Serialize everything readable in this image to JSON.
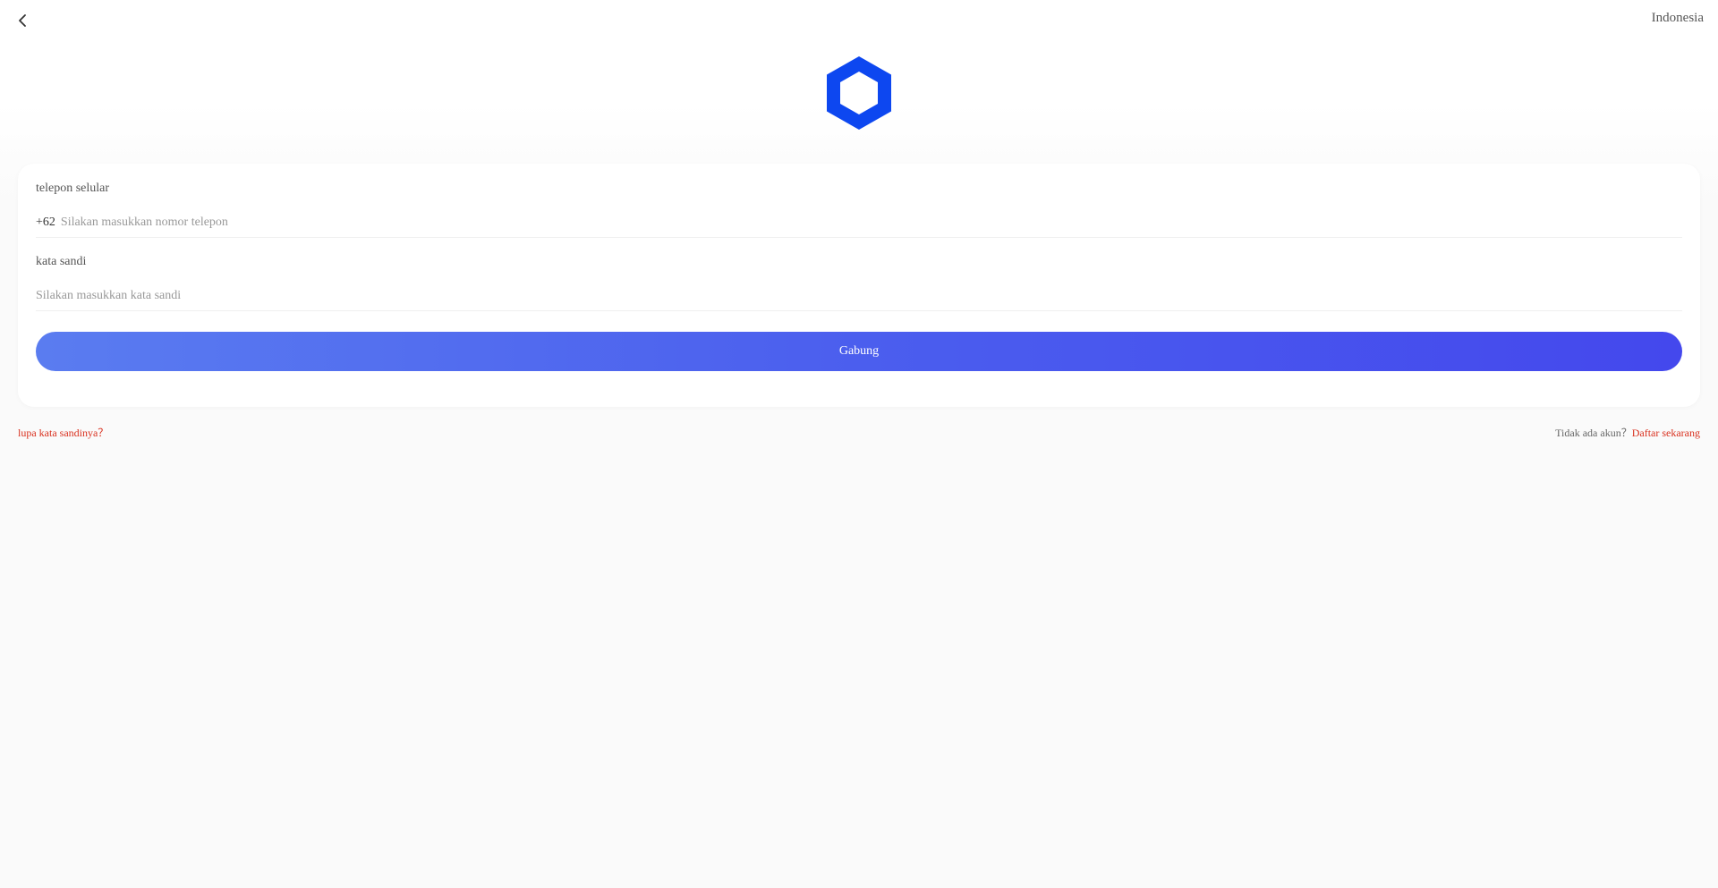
{
  "header": {
    "back_icon": "chevron-left-icon",
    "language": "Indonesia"
  },
  "logo": {
    "icon": "hexagon-logo-icon",
    "color": "#0d47f0"
  },
  "form": {
    "phone": {
      "label": "telepon selular",
      "prefix": "+62",
      "value": "",
      "placeholder": "Silakan masukkan nomor telepon"
    },
    "password": {
      "label": "kata sandi",
      "value": "",
      "placeholder": "Silakan masukkan kata sandi"
    },
    "submit_label": "Gabung"
  },
  "footer": {
    "forgot_password": "lupa kata sandinya？",
    "no_account": "Tidak ada akun？",
    "register_now": "Daftar sekarang"
  },
  "colors": {
    "accent": "#4b5eee",
    "link": "#d9301e"
  }
}
